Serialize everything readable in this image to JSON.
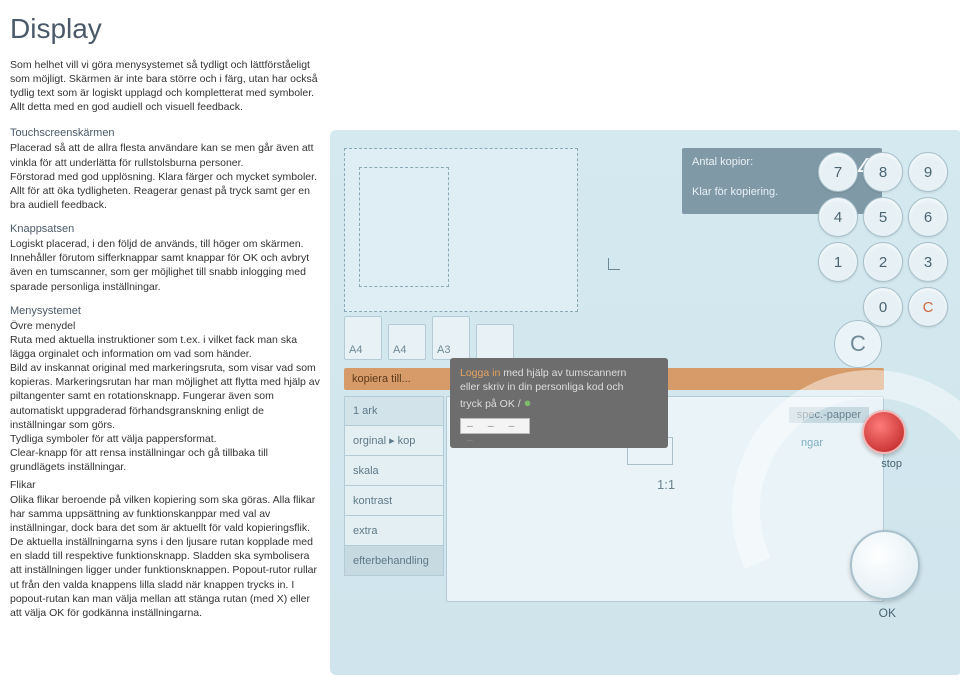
{
  "page": {
    "title": "Display",
    "intro": "Som helhet vill vi göra menysystemet så tydligt och lättförståeligt som möjligt. Skärmen är inte bara större och i färg, utan har också tydlig text som är logiskt upplagd och kompletterat med symboler. Allt detta med en god audiell och visuell feedback."
  },
  "sections": {
    "touchscreen": {
      "title": "Touchscreenskärmen",
      "body": "Placerad så att de allra flesta användare kan se men går även att vinkla för att underlätta för rullstolsburna personer.\nFörstorad med god upplösning. Klara färger och mycket symboler. Allt för att öka tydligheten. Reagerar genast på tryck samt ger en bra audiell feedback."
    },
    "knappsatsen": {
      "title": "Knappsatsen",
      "body": "Logiskt placerad, i den följd de används, till höger om skärmen. Innehåller förutom sifferknappar samt knappar för OK och avbryt även en tumscanner, som ger möjlighet till snabb inlogging med sparade personliga inställningar."
    },
    "menysystemet": {
      "title": "Menysystemet",
      "ovre_title": "Övre menydel",
      "ovre_body": "Ruta med aktuella instruktioner som t.ex. i vilket fack man ska lägga orginalet och information om vad som händer.\nBild av inskannat original med markeringsruta, som visar vad som kopieras. Markeringsrutan har man möjlighet att flytta med hjälp av piltangenter samt en rotationsknapp. Fungerar även som automatiskt uppgraderad förhandsgranskning enligt de inställningar som görs.\nTydliga symboler för att välja pappersformat.\nClear-knapp för att rensa inställningar och gå tillbaka till grundlägets inställningar.",
      "flikar_title": "Flikar",
      "flikar_body": "Olika flikar beroende på vilken kopiering som ska göras. Alla flikar har samma uppsättning av funktionskanppar med val av inställningar, dock bara det som är aktuellt för vald kopieringsflik. De aktuella inställningarna syns i den ljusare rutan kopplade med en sladd till respektive funktionsknapp. Sladden ska symbolisera att inställningen ligger under funktionsknappen. Popout-rutor rullar ut från den valda knappens lilla sladd när knappen trycks in. I popout-rutan kan man välja mellan att stänga rutan (med X) eller att välja OK för godkänna inställningarna."
    }
  },
  "infobox": {
    "line1": "Antal kopior:",
    "count": "4",
    "line2": "Klar för kopiering."
  },
  "paper": {
    "a4a": "A4",
    "a4b": "A4",
    "a3": "A3"
  },
  "clear": "C",
  "orangebar": "kopiera till...",
  "tooltip": {
    "l1a": "Logga in",
    "l1b": " med hjälp av tumscannern",
    "l2": "eller skriv in din personliga kod och",
    "l3": "tryck på OK / ",
    "dashes": "– – – –"
  },
  "options": {
    "ark": "1 ark",
    "orginal": "orginal ▸ kop",
    "skala": "skala",
    "kontrast": "kontrast",
    "extra": "extra",
    "efterbehandling": "efterbehandling"
  },
  "content": {
    "ratio": "1:1",
    "spec": "spec.-papper",
    "ngar": "ngar"
  },
  "keypad": {
    "k7": "7",
    "k8": "8",
    "k9": "9",
    "k4": "4",
    "k5": "5",
    "k6": "6",
    "k1": "1",
    "k2": "2",
    "k3": "3",
    "k0": "0",
    "kc": "C"
  },
  "stop": "stop",
  "ok": "OK"
}
